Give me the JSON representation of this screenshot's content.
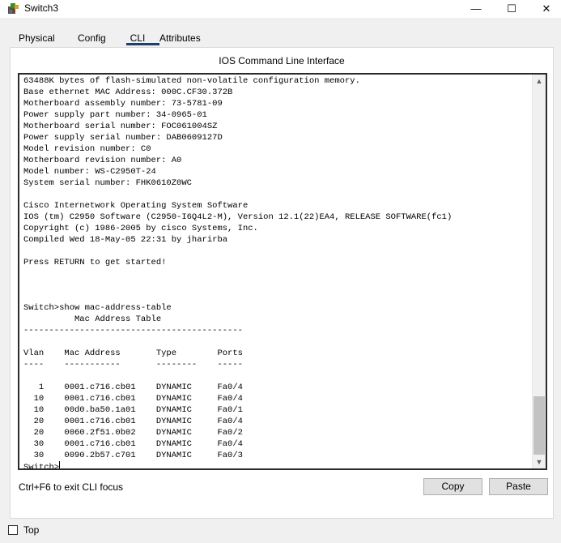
{
  "window": {
    "title": "Switch3",
    "minimize_glyph": "—",
    "maximize_glyph": "☐",
    "close_glyph": "✕"
  },
  "tabs": [
    {
      "label": "Physical",
      "active": false
    },
    {
      "label": "Config",
      "active": false
    },
    {
      "label": "CLI",
      "active": true
    },
    {
      "label": "Attributes",
      "active": false
    }
  ],
  "panel": {
    "title": "IOS Command Line Interface"
  },
  "terminal": {
    "lines": [
      "63488K bytes of flash-simulated non-volatile configuration memory.",
      "Base ethernet MAC Address: 000C.CF30.372B",
      "Motherboard assembly number: 73-5781-09",
      "Power supply part number: 34-0965-01",
      "Motherboard serial number: FOC061004SZ",
      "Power supply serial number: DAB0609127D",
      "Model revision number: C0",
      "Motherboard revision number: A0",
      "Model number: WS-C2950T-24",
      "System serial number: FHK0610Z0WC",
      "",
      "Cisco Internetwork Operating System Software",
      "IOS (tm) C2950 Software (C2950-I6Q4L2-M), Version 12.1(22)EA4, RELEASE SOFTWARE(fc1)",
      "Copyright (c) 1986-2005 by cisco Systems, Inc.",
      "Compiled Wed 18-May-05 22:31 by jharirba",
      "",
      "Press RETURN to get started!",
      "",
      "",
      "",
      "Switch>show mac-address-table",
      "          Mac Address Table",
      "-------------------------------------------",
      "",
      "Vlan    Mac Address       Type        Ports",
      "----    -----------       --------    -----",
      "",
      "   1    0001.c716.cb01    DYNAMIC     Fa0/4",
      "  10    0001.c716.cb01    DYNAMIC     Fa0/4",
      "  10    00d0.ba50.1a01    DYNAMIC     Fa0/1",
      "  20    0001.c716.cb01    DYNAMIC     Fa0/4",
      "  20    0060.2f51.0b02    DYNAMIC     Fa0/2",
      "  30    0001.c716.cb01    DYNAMIC     Fa0/4",
      "  30    0090.2b57.c701    DYNAMIC     Fa0/3"
    ],
    "prompt": "Switch>",
    "scroll_up_glyph": "▲",
    "scroll_down_glyph": "▼"
  },
  "footer": {
    "hint": "Ctrl+F6 to exit CLI focus",
    "copy_label": "Copy",
    "paste_label": "Paste",
    "top_label": "Top",
    "top_checked": false
  },
  "colors": {
    "active_tab_underline": "#1e3f6e",
    "terminal_border": "#2b2b2b",
    "window_bg": "#f0f0f0"
  }
}
